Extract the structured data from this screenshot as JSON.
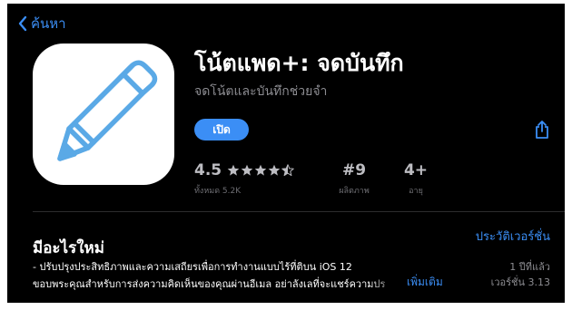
{
  "nav": {
    "back_label": "ค้นหา"
  },
  "app": {
    "name": "โน้ตแพด+: จดบันทึก",
    "subtitle": "จดโน้ตและบันทึกช่วยจำ",
    "open_label": "เปิด"
  },
  "stats": {
    "rating": {
      "value": "4.5",
      "stars_out_of_5": 4.5,
      "caption": "ทั้งหมด 5.2K"
    },
    "rank": {
      "value": "#9",
      "caption": "ผลิตภาพ"
    },
    "age": {
      "value": "4+",
      "caption": "อายุ"
    }
  },
  "whats_new": {
    "heading": "มีอะไรใหม่",
    "history_label": "ประวัติเวอร์ชั่น",
    "notes_line1": "- ปรับปรุงประสิทธิภาพและความเสถียรเพื่อการทำงานแบบไร้ที่ติบน iOS 12",
    "notes_line2": "ขอบพระคุณสำหรับการส่งความคิดเห็นของคุณผ่านอีเมล อย่าลังเลที่จะแชร์ความปร",
    "more_label": "เพิ่มเติม",
    "time_ago": "1 ปีที่แล้ว",
    "version": "เวอร์ชั่น 3.13"
  },
  "colors": {
    "accent": "#3b8ef5",
    "background": "#000000",
    "icon_stroke": "#5aa9e6"
  },
  "icons": {
    "back": "chevron-left-icon",
    "share": "share-icon",
    "app": "pen-icon"
  }
}
